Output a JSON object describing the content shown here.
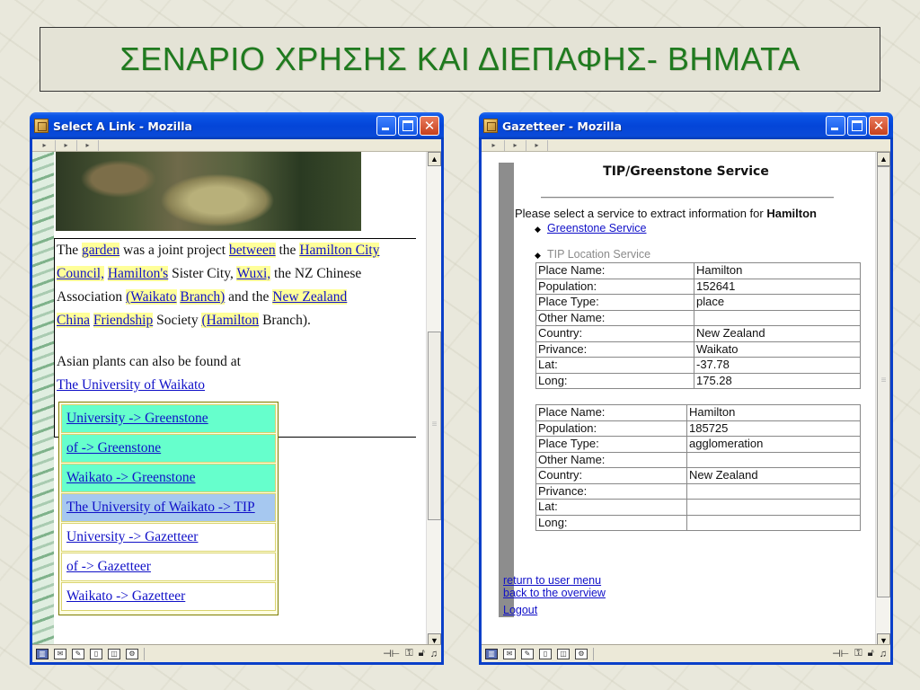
{
  "slide": {
    "title": "ΣΕΝΑΡΙΟ ΧΡΗΣΗΣ ΚΑΙ ΔΙΕΠΑΦΗΣ- ΒΗΜΑΤΑ"
  },
  "left_window": {
    "title": "Select A Link - Mozilla",
    "article": {
      "p1": {
        "t1": "The ",
        "l1": "garden",
        "t2": " was a joint project ",
        "l2": "between",
        "t3": " the ",
        "l3": "Hamilton City",
        "l4": "Council,",
        "t4": " ",
        "l5": "Hamilton's",
        "t5": " Sister City, ",
        "l6": "Wuxi,",
        "t6": " the NZ Chinese",
        "t7": "Association ",
        "l7": "(Waikato",
        "t8": " ",
        "l8": "Branch)",
        "t9": " and the ",
        "l9": "New Zealand",
        "l10": "China",
        "t10": " ",
        "l11": "Friendship",
        "t11": " Society ",
        "l12": "(Hamilton",
        "t12": " Branch)."
      },
      "p2_text": "Asian plants can also be found at",
      "p2_link": "The University of Waikato"
    },
    "popup_items": [
      {
        "label": "University -> Greenstone",
        "style": "green"
      },
      {
        "label": "of -> Greenstone",
        "style": "green"
      },
      {
        "label": "Waikato -> Greenstone",
        "style": "green"
      },
      {
        "label": "The University of Waikato -> TIP",
        "style": "blue"
      },
      {
        "label": "University -> Gazetteer",
        "style": "white"
      },
      {
        "label": "of -> Gazetteer",
        "style": "white"
      },
      {
        "label": "Waikato -> Gazetteer",
        "style": "white"
      }
    ]
  },
  "right_window": {
    "title": "Gazetteer - Mozilla",
    "heading": "TIP/Greenstone Service",
    "prompt_text": "Please select a service to extract information for ",
    "prompt_place": "Hamilton",
    "service_1": "Greenstone Service",
    "service_2": "TIP Location Service",
    "table1": [
      [
        "Place Name:",
        "Hamilton"
      ],
      [
        "Population:",
        "152641"
      ],
      [
        "Place Type:",
        "place"
      ],
      [
        "Other Name:",
        ""
      ],
      [
        "Country:",
        "New Zealand"
      ],
      [
        "Privance:",
        "Waikato"
      ],
      [
        "Lat:",
        "-37.78"
      ],
      [
        "Long:",
        "175.28"
      ]
    ],
    "table2": [
      [
        "Place Name:",
        "Hamilton"
      ],
      [
        "Population:",
        "185725"
      ],
      [
        "Place Type:",
        "agglomeration"
      ],
      [
        "Other Name:",
        ""
      ],
      [
        "Country:",
        "New Zealand"
      ],
      [
        "Privance:",
        ""
      ],
      [
        "Lat:",
        ""
      ],
      [
        "Long:",
        ""
      ]
    ],
    "links": {
      "return": "return to user menu",
      "back": "back to the overview",
      "logout": "Logout"
    }
  }
}
